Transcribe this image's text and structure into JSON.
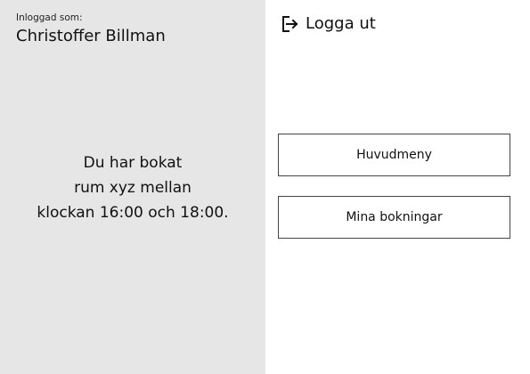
{
  "session": {
    "logged_in_caption": "Inloggad som:",
    "user_name": "Christoffer Billman",
    "logout_label": "Logga ut",
    "logout_icon": "logout-icon"
  },
  "confirmation": {
    "line1": "Du har bokat",
    "line2": "rum xyz mellan",
    "line3": "klockan 16:00 och 18:00."
  },
  "navigation": {
    "main_menu_label": "Huvudmeny",
    "my_bookings_label": "Mina bokningar"
  },
  "colors": {
    "left_panel_background": "#e6e6e6",
    "right_panel_background": "#ffffff",
    "text": "#111111",
    "button_border": "#444444"
  }
}
